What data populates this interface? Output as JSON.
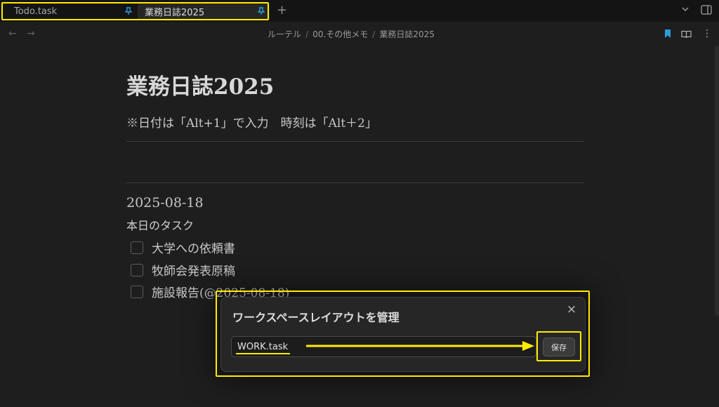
{
  "tabs": [
    {
      "label": "Todo.task",
      "pinned": true,
      "active": false
    },
    {
      "label": "業務日誌2025",
      "pinned": true,
      "active": true
    }
  ],
  "tabbar": {
    "new_tab_glyph": "+"
  },
  "breadcrumb": [
    "ルーテル",
    "00.その他メモ",
    "業務日誌2025"
  ],
  "breadcrumb_separator": "/",
  "nav": {
    "back_glyph": "←",
    "forward_glyph": "→",
    "more_glyph": "⋮"
  },
  "document": {
    "title": "業務日誌2025",
    "note": "※日付は「Alt+1」で入力　時刻は「Alt＋2」",
    "date": "2025-08-18",
    "tasks_heading": "本日のタスク",
    "tasks": [
      {
        "label": "大学への依頼書",
        "checked": false
      },
      {
        "label": "牧師会発表原稿",
        "checked": false
      },
      {
        "label": "施設報告(@2025-08-18)",
        "checked": false
      }
    ]
  },
  "dialog": {
    "title": "ワークスペースレイアウトを管理",
    "close_glyph": "×",
    "input_value": "WORK.task",
    "save_label": "保存"
  },
  "icons": {
    "pin": "pin-icon",
    "bookmark": "bookmark-icon",
    "reading_mode": "book-open-icon",
    "sidebar_toggle": "sidebar-right-icon",
    "tab_menu": "chevron-down-icon"
  },
  "colors": {
    "accent": "#2d9bd8",
    "annotation": "#ffeb00",
    "background": "#1e1e1e",
    "tabbar": "#141414"
  }
}
